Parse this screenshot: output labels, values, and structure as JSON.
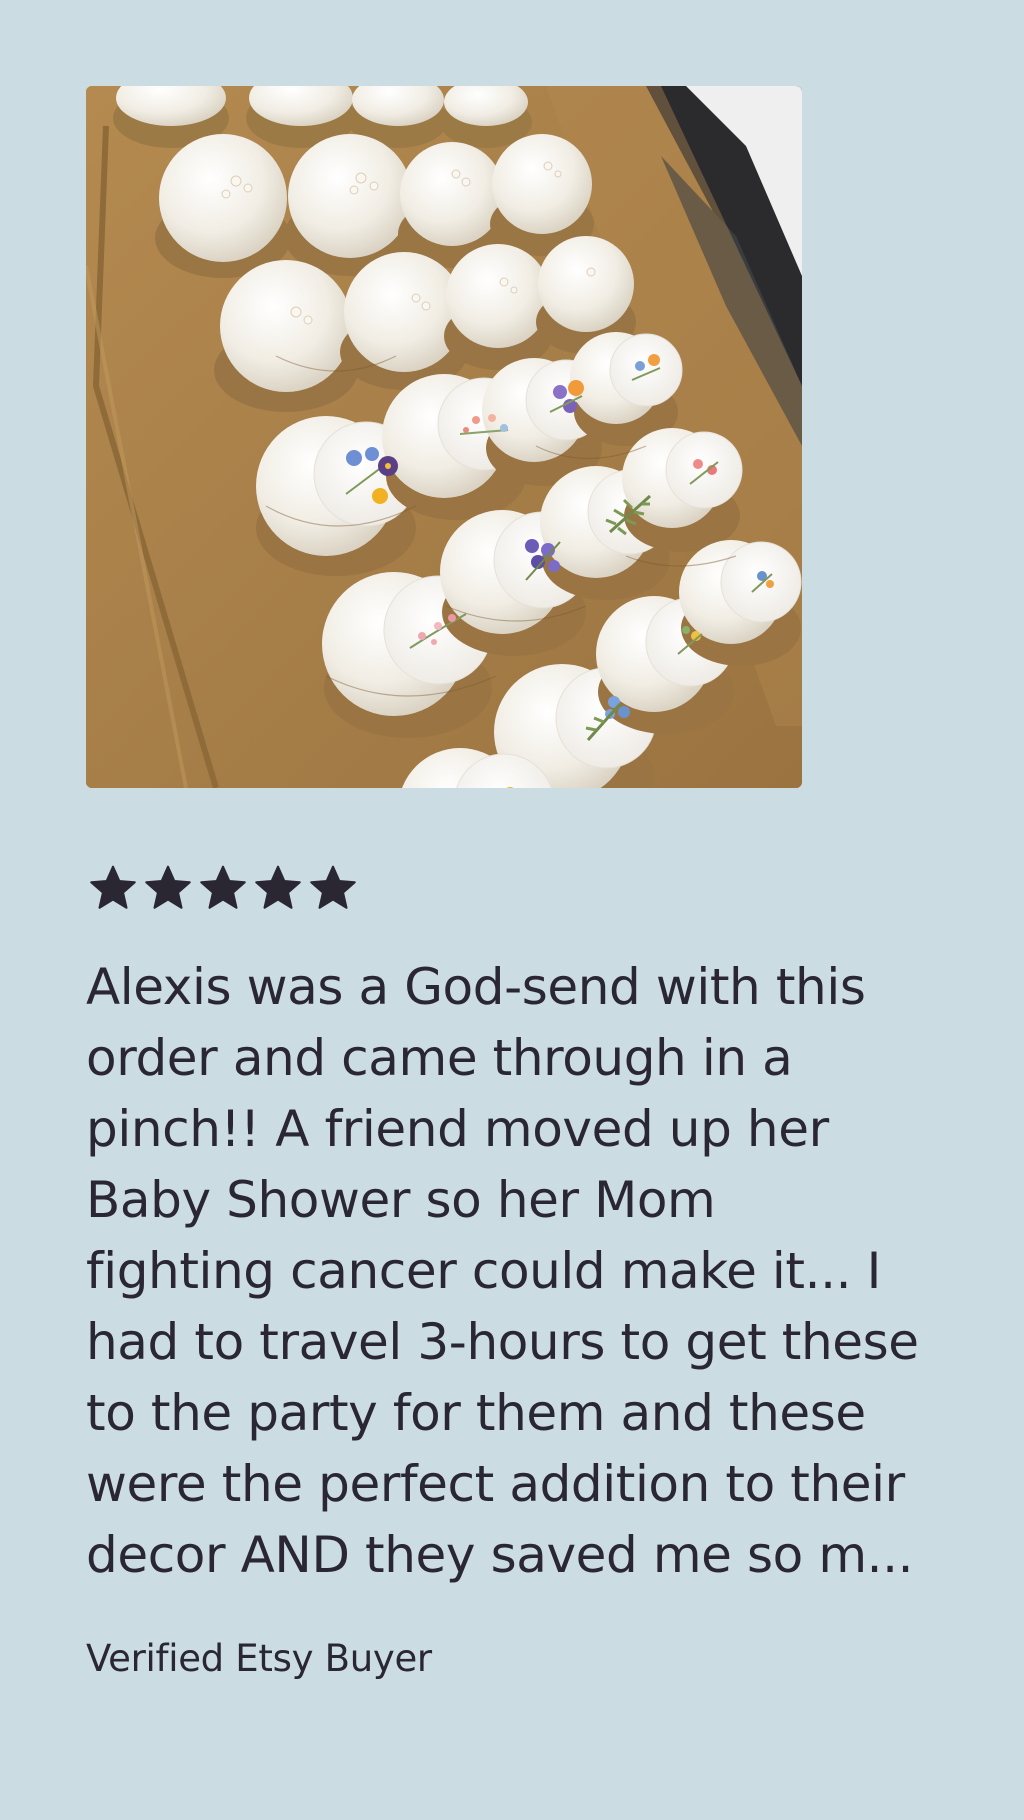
{
  "review": {
    "photo_icon": "cupcakes-photo",
    "rating": {
      "stars": 5,
      "max": 5,
      "star_icon": "star-icon"
    },
    "text": "Alexis was a God-send with this\norder and came through in a\npinch!! A friend moved up her\nBaby Shower so her Mom\nfighting cancer could make it... I\nhad to travel 3-hours to get these\nto the party for them and these\nwere the perfect addition to their\ndecor AND they saved me so m...",
    "reviewer": "Verified Etsy Buyer"
  },
  "colors": {
    "background": "#cbdce3",
    "text": "#2a2733",
    "star": "#2a2733"
  }
}
